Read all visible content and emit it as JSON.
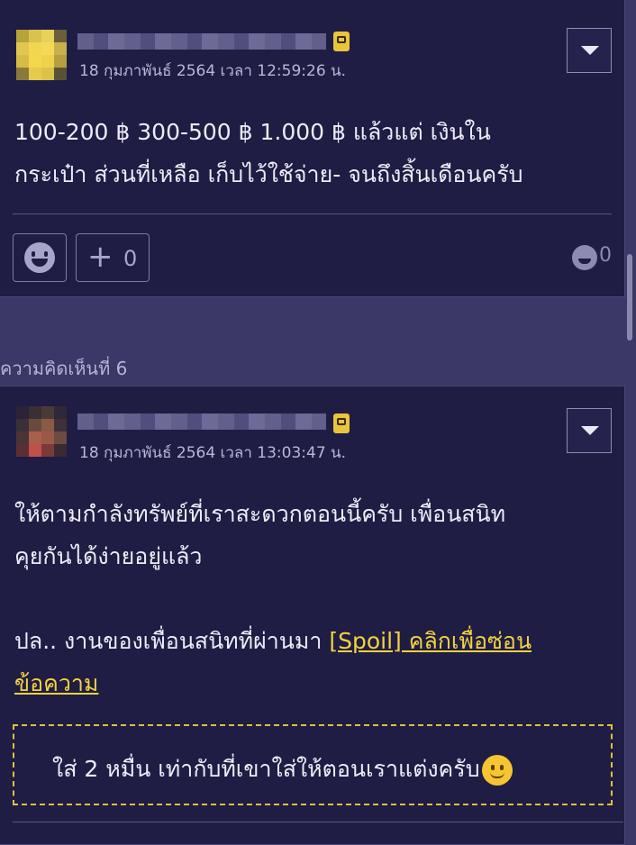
{
  "comment1": {
    "timestamp": "18 กุมภาพันธ์ 2564 เวลา 12:59:26 น.",
    "body_line1": "100-200 ฿ 300-500 ฿ 1.000 ฿ แล้วแต่ เงินใน",
    "body_line2": "กระเป๋า ส่วนที่เหลือ เก็บไว้ใช้จ่าย- จนถึงสิ้นเดือนครับ",
    "plus_count": "0",
    "reaction_count": "0"
  },
  "comment2": {
    "label": "ความคิดเห็นที่ 6",
    "timestamp": "18 กุมภาพันธ์ 2564 เวลา 13:03:47 น.",
    "body_line1": "ให้ตามกำลังทรัพย์ที่เราสะดวกตอนนี้ครับ เพื่อนสนิท",
    "body_line2": "คุยกันได้ง่ายอยู่แล้ว",
    "body_line3_prefix": "ปล.. งานของเพื่อนสนิทที่ผ่านมา ",
    "spoil_link_part1": "[Spoil] คลิกเพื่อซ่อน",
    "spoil_link_part2": "ข้อความ",
    "spoil_content": "ใส่ 2 หมื่น เท่ากับที่เขาใส่ให้ตอนเราแต่งครับ"
  },
  "icons": {
    "menu": "chevron-down-icon",
    "emoji": "smile-icon",
    "plus": "plus-icon"
  },
  "colors": {
    "card_bg": "#1f1d44",
    "page_bg": "#3b3766",
    "spoil_accent": "#f3d23f"
  }
}
